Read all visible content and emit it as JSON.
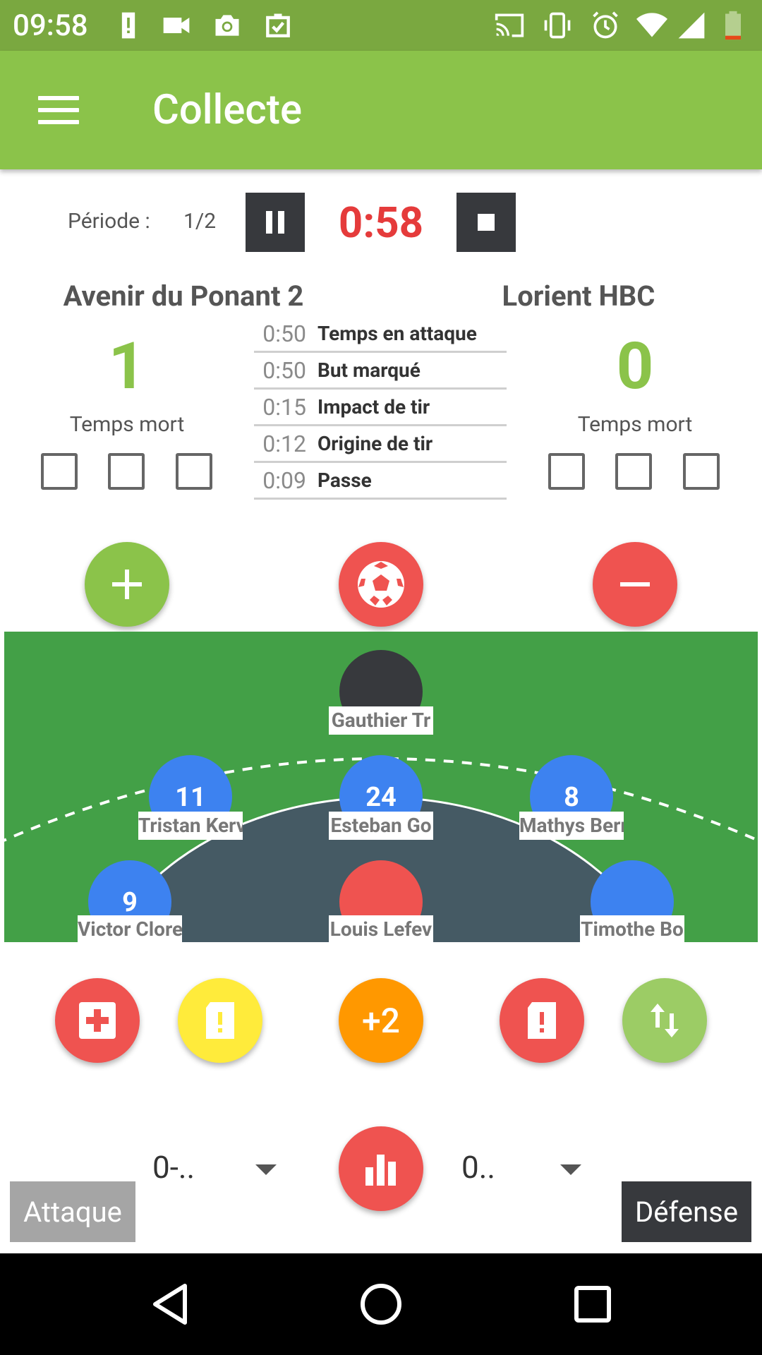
{
  "status_bar": {
    "time": "09:58",
    "left_icons": [
      "alert-icon",
      "video-icon",
      "camera-icon",
      "clipboard-check-icon"
    ],
    "right_icons": [
      "cast-icon",
      "vibrate-icon",
      "alarm-icon",
      "wifi-icon",
      "signal-icon",
      "battery-low-icon"
    ]
  },
  "app_bar": {
    "title": "Collecte",
    "menu_icon": "menu-icon"
  },
  "period": {
    "label": "Période :",
    "value": "1/2",
    "clock": "0:58"
  },
  "team_left": {
    "name": "Avenir du Ponant 2",
    "score": "1",
    "timeout_label": "Temps mort",
    "timeouts": [
      false,
      false,
      false
    ]
  },
  "team_right": {
    "name": "Lorient HBC",
    "score": "0",
    "timeout_label": "Temps mort",
    "timeouts": [
      false,
      false,
      false
    ]
  },
  "events": [
    {
      "time": "0:50",
      "name": "Temps en attaque"
    },
    {
      "time": "0:50",
      "name": "But marqué"
    },
    {
      "time": "0:15",
      "name": "Impact de tir"
    },
    {
      "time": "0:12",
      "name": "Origine de tir"
    },
    {
      "time": "0:09",
      "name": "Passe"
    }
  ],
  "field_players": [
    {
      "number": "",
      "name": "Gauthier Tr",
      "color": "#37393d"
    },
    {
      "number": "11",
      "name": "Tristan Kerv",
      "color": "#3d82f0"
    },
    {
      "number": "24",
      "name": "Esteban Go",
      "color": "#3d82f0"
    },
    {
      "number": "8",
      "name": "Mathys Berr",
      "color": "#3d82f0"
    },
    {
      "number": "9",
      "name": "Victor Clore",
      "color": "#3d82f0"
    },
    {
      "number": "",
      "name": "Louis Lefev",
      "color": "#ef5350"
    },
    {
      "number": "",
      "name": "Timothe Bo",
      "color": "#3d82f0"
    }
  ],
  "actions": {
    "plus2_label": "+2"
  },
  "bottom": {
    "dropdown_left_value": "0-..",
    "dropdown_right_value": "0..",
    "attaque_label": "Attaque",
    "defense_label": "Défense"
  },
  "colors": {
    "primary": "#8bc34a",
    "red": "#ef5350",
    "yellow": "#ffeb3b",
    "orange": "#ff9800",
    "field": "#43a047",
    "dark": "#37393d"
  }
}
